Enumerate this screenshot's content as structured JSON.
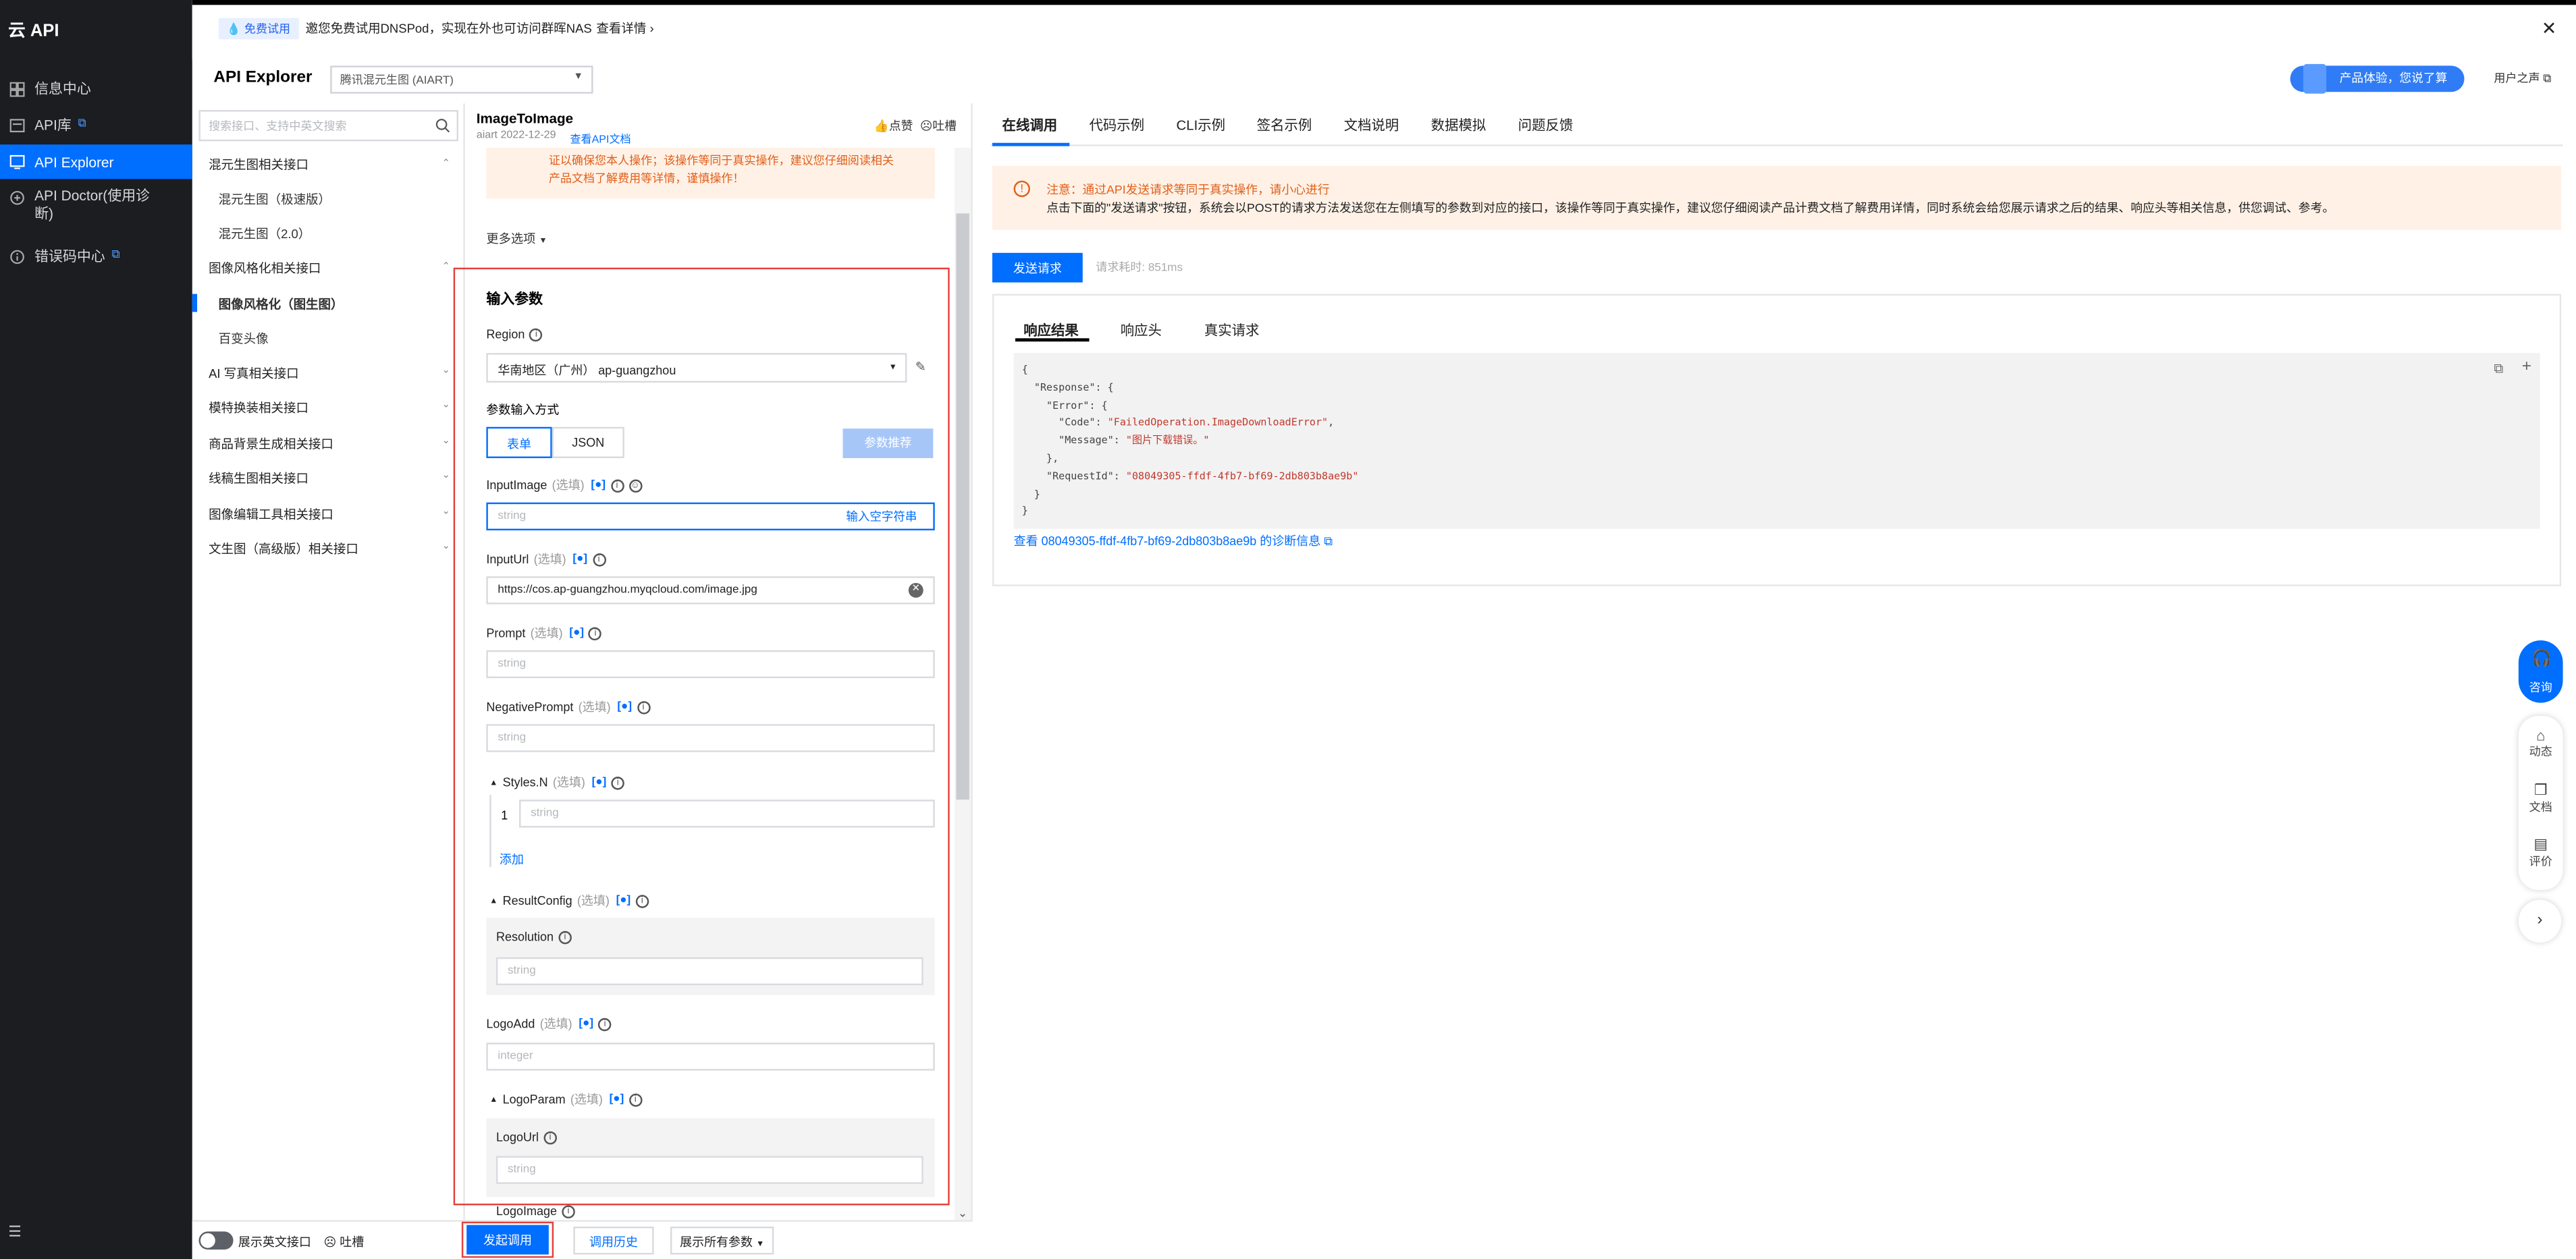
{
  "sidebar": {
    "brand": "云 API",
    "items": [
      {
        "label": "信息中心",
        "icon": "grid-icon"
      },
      {
        "label": "API库",
        "icon": "library-icon"
      },
      {
        "label": "API Explorer",
        "icon": "terminal-icon"
      },
      {
        "label": "API Doctor(使用诊断)",
        "icon": "doctor-icon"
      },
      {
        "label": "错误码中心",
        "icon": "info-circle-icon"
      }
    ],
    "menu_icon": "menu-icon"
  },
  "notice": {
    "badge": "免费试用",
    "text": "邀您免费试用DNSPod，实现在外也可访问群晖NAS",
    "link": "查看详情"
  },
  "header": {
    "title": "API Explorer",
    "product": "腾讯混元生图 (AIART)",
    "promo": "产品体验，您说了算",
    "user_voice": "用户之声"
  },
  "api_list": {
    "search_placeholder": "搜索接口、支持中英文搜索",
    "groups": [
      {
        "label": "混元生图相关接口",
        "children": [
          "混元生图（极速版）",
          "混元生图（2.0）"
        ]
      },
      {
        "label": "图像风格化相关接口",
        "children": [
          "图像风格化（图生图）",
          "百变头像"
        ]
      },
      {
        "label": "AI 写真相关接口",
        "children": []
      },
      {
        "label": "模特换装相关接口",
        "children": []
      },
      {
        "label": "商品背景生成相关接口",
        "children": []
      },
      {
        "label": "线稿生图相关接口",
        "children": []
      },
      {
        "label": "图像编辑工具相关接口",
        "children": []
      },
      {
        "label": "文生图（高级版）相关接口",
        "children": []
      }
    ]
  },
  "doc": {
    "title": "ImageToImage",
    "meta": "aiart 2022-12-29",
    "doc_link": "查看API文档",
    "like": "点赞",
    "complain": "吐槽",
    "warning": "证以确保您本人操作；该操作等同于真实操作，建议您仔细阅读相关产品文档了解费用等详情，谨慎操作！",
    "more_options": "更多选项"
  },
  "params": {
    "heading": "输入参数",
    "region_label": "Region",
    "region_value": "华南地区（广州） ap-guangzhou",
    "mode_label": "参数输入方式",
    "tab_form": "表单",
    "tab_json": "JSON",
    "recommend_button": "参数推荐",
    "optional_tag": "(选填)",
    "input_image": {
      "label": "InputImage",
      "placeholder": "string",
      "action": "输入空字符串"
    },
    "input_url": {
      "label": "InputUrl",
      "value": "https://cos.ap-guangzhou.myqcloud.com/image.jpg"
    },
    "prompt": {
      "label": "Prompt",
      "placeholder": "string"
    },
    "negative_prompt": {
      "label": "NegativePrompt",
      "placeholder": "string"
    },
    "styles": {
      "label": "Styles.N",
      "index": "1",
      "placeholder": "string",
      "add": "添加"
    },
    "result_config": {
      "label": "ResultConfig",
      "resolution_label": "Resolution",
      "placeholder": "string"
    },
    "logo_add": {
      "label": "LogoAdd",
      "placeholder": "integer"
    },
    "logo_param": {
      "label": "LogoParam",
      "logo_url_label": "LogoUrl",
      "placeholder": "string"
    },
    "logo_image": {
      "label": "LogoImage"
    }
  },
  "bottom": {
    "show_en": "展示英文接口",
    "complain": "吐槽",
    "run": "发起调用",
    "history": "调用历史",
    "show_all": "展示所有参数"
  },
  "right": {
    "tabs": [
      "在线调用",
      "代码示例",
      "CLI示例",
      "签名示例",
      "文档说明",
      "数据模拟",
      "问题反馈"
    ],
    "note_title": "注意：通过API发送请求等同于真实操作，请小心进行",
    "note_body": "点击下面的\"发送请求\"按钮，系统会以POST的请求方法发送您在左侧填写的参数到对应的接口，该操作等同于真实操作，建议您仔细阅读产品计费文档了解费用详情，同时系统会给您展示请求之后的结果、响应头等相关信息，供您调试、参考。",
    "send": "发送请求",
    "elapsed": "请求耗时: 851ms",
    "sub_tabs": [
      "响应结果",
      "响应头",
      "真实请求"
    ],
    "response": {
      "code_key": "\"Code\"",
      "code_val": "\"FailedOperation.ImageDownloadError\"",
      "msg_key": "\"Message\"",
      "msg_val": "\"图片下载错误。\"",
      "req_key": "\"RequestId\"",
      "req_val": "\"08049305-ffdf-4fb7-bf69-2db803b8ae9b\""
    },
    "diag_link": "查看 08049305-ffdf-4fb7-bf69-2db803b8ae9b 的诊断信息"
  },
  "float": {
    "consult": "咨询",
    "items": [
      "动态",
      "文档",
      "评价"
    ]
  },
  "colors": {
    "accent": "#006eff",
    "warning": "#e0601a",
    "sidebar_bg": "#1b1d21"
  }
}
